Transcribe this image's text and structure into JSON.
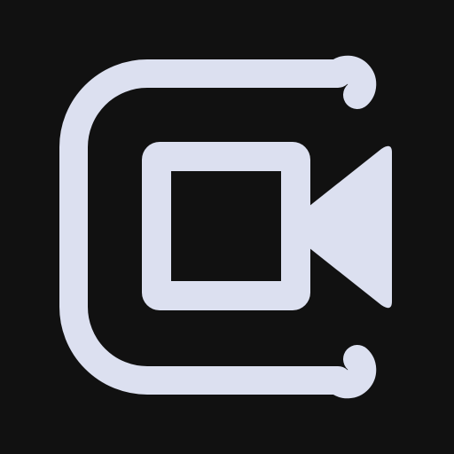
{
  "icon": {
    "name": "video-camera-app-icon",
    "colors": {
      "background": "#111111",
      "glyph": "#DCE0F0"
    },
    "elements": [
      "c-outline-arc",
      "camera-body",
      "camera-lens-triangle"
    ]
  }
}
